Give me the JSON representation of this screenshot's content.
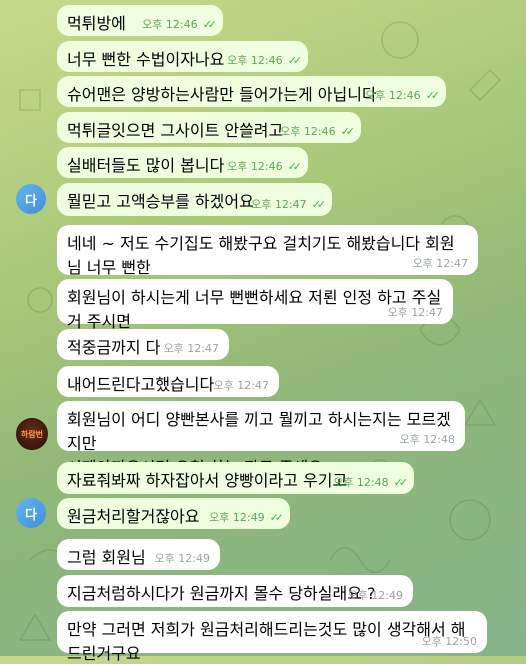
{
  "messages": [
    {
      "text": "먹튀방에",
      "time": "오후 12:46",
      "ticks": "✓✓"
    },
    {
      "text": "너무 뻔한 수법이자나요",
      "time": "오후 12:46",
      "ticks": "✓✓"
    },
    {
      "text": "슈어맨은 양방하는사람만 들어가는게 아닙니다",
      "time": "오후 12:46",
      "ticks": "✓✓"
    },
    {
      "text": "먹튀글잇으면 그사이트 안쓸려고",
      "time": "오후 12:46",
      "ticks": "✓✓"
    },
    {
      "text": "실배터들도 많이 봅니다",
      "time": "오후 12:46",
      "ticks": "✓✓"
    },
    {
      "text": "뭘믿고 고액승부를 하겠어요",
      "time": "오후 12:47",
      "ticks": "✓✓"
    },
    {
      "text": "네네 ~ 저도 수기집도 해봤구요 걸치기도 해봤습니다 회원님 너무 뻔한\n레파토리구요",
      "time": "오후 12:47"
    },
    {
      "text": "회원님이 하시는게 너무 뻔뻔하세요 저뢴 인정 하고 주실거 주시면",
      "time": "오후 12:47"
    },
    {
      "text": "적중금까지 다",
      "time": "오후 12:47"
    },
    {
      "text": "내어드린다고했습니다",
      "time": "오후 12:47"
    },
    {
      "text": "회원님이 어디 양빤본사를 끼고 뭘끼고 하시는지는 모르겠지만\n시제아까우시면 요청 하는 자료 주세요",
      "time": "오후 12:48"
    },
    {
      "text": "자료줘봐짜 하자잡아서 양빵이라고 우기고",
      "time": "오후 12:48",
      "ticks": "✓✓"
    },
    {
      "text": "원금처리할거잖아요",
      "time": "오후 12:49",
      "ticks": "✓✓"
    },
    {
      "text": "그럼 회원님",
      "time": "오후 12:49"
    },
    {
      "text": "지금처럼하시다가 원금까지 몰수 당하실래요 ?",
      "time": "오후 12:49"
    },
    {
      "text": "만약 그러면 저희가 원금처리해드리는것도 많이 생각해서 해드린거구요",
      "time": "오후 12:50"
    }
  ],
  "avatars": {
    "user_initial": "다",
    "agent_logo_text": "하람번"
  },
  "colors": {
    "outgoing_bubble": "#eefedf",
    "incoming_bubble": "#ffffff",
    "avatar_blue": "#4c9fe0",
    "tick_green": "#4fae4e"
  }
}
